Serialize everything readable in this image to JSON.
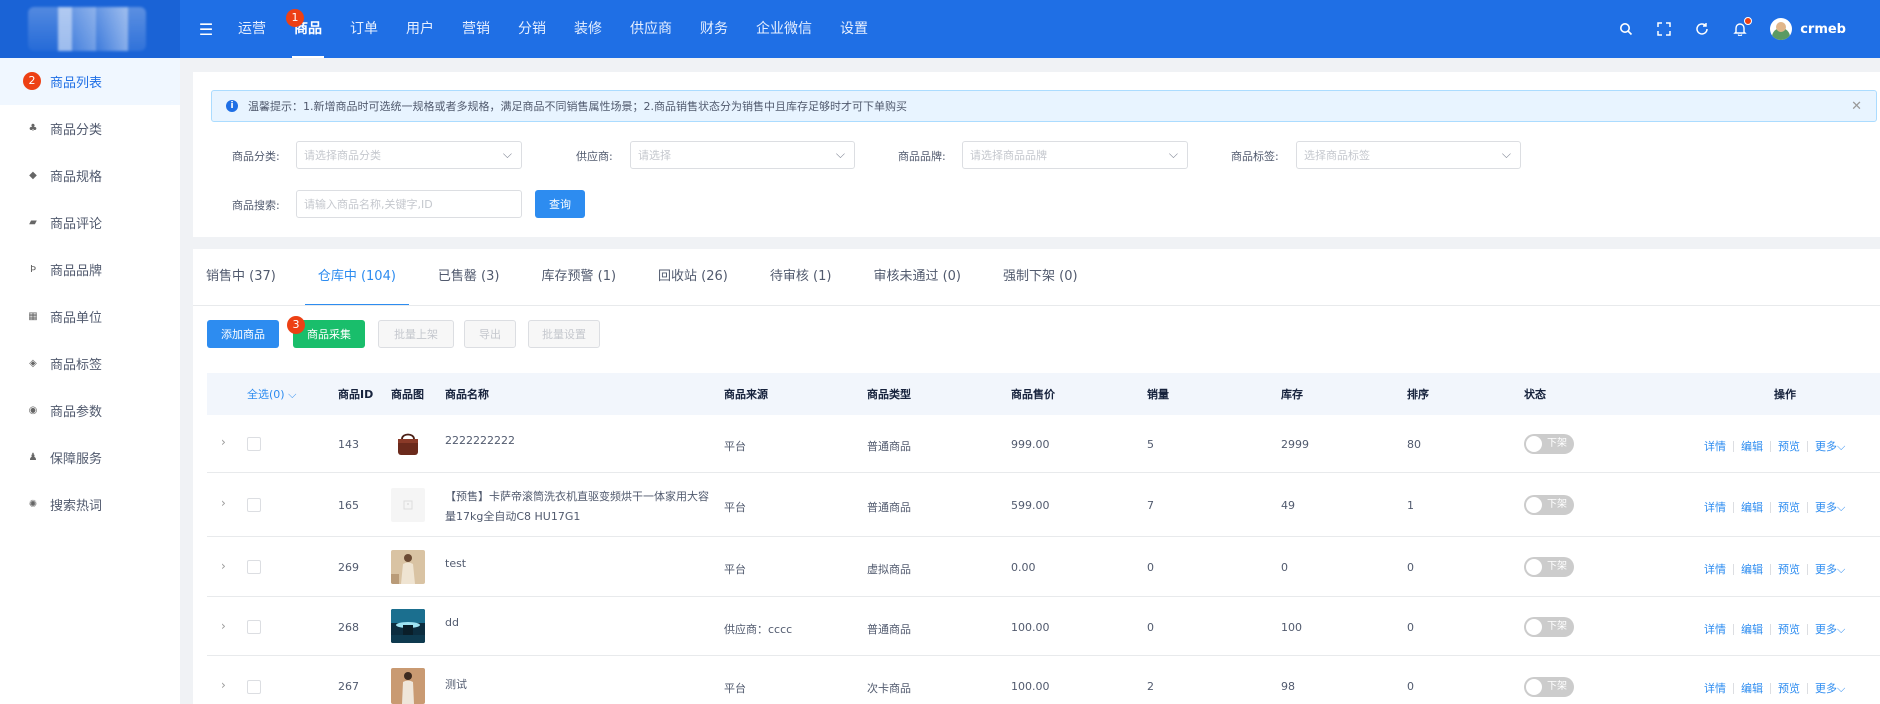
{
  "header": {
    "nav": [
      {
        "label": "运营"
      },
      {
        "label": "商品",
        "badge": "1"
      },
      {
        "label": "订单"
      },
      {
        "label": "用户"
      },
      {
        "label": "营销"
      },
      {
        "label": "分销"
      },
      {
        "label": "装修"
      },
      {
        "label": "供应商"
      },
      {
        "label": "财务"
      },
      {
        "label": "企业微信"
      },
      {
        "label": "设置"
      }
    ],
    "active_nav_index": 1,
    "icons": [
      "search-icon",
      "fullscreen-icon",
      "refresh-icon",
      "bell-icon"
    ],
    "username": "crmeb"
  },
  "sidebar": {
    "items": [
      {
        "label": "商品列表",
        "icon": "list-icon",
        "badge": "2"
      },
      {
        "label": "商品分类",
        "icon": "category-icon"
      },
      {
        "label": "商品规格",
        "icon": "spec-icon"
      },
      {
        "label": "商品评论",
        "icon": "comment-icon"
      },
      {
        "label": "商品品牌",
        "icon": "brand-icon"
      },
      {
        "label": "商品单位",
        "icon": "unit-icon"
      },
      {
        "label": "商品标签",
        "icon": "tag-icon"
      },
      {
        "label": "商品参数",
        "icon": "param-icon"
      },
      {
        "label": "保障服务",
        "icon": "guarantee-icon"
      },
      {
        "label": "搜索热词",
        "icon": "hotword-icon"
      }
    ]
  },
  "tip": {
    "text": "温馨提示：1.新增商品时可选统一规格或者多规格，满足商品不同销售属性场景；2.商品销售状态分为销售中且库存足够时才可下单购买"
  },
  "filters": {
    "category_label": "商品分类:",
    "category_placeholder": "请选择商品分类",
    "supplier_label": "供应商:",
    "supplier_placeholder": "请选择",
    "brand_label": "商品品牌:",
    "brand_placeholder": "请选择商品品牌",
    "tag_label": "商品标签:",
    "tag_placeholder": "选择商品标签",
    "search_label": "商品搜索:",
    "search_placeholder": "请输入商品名称,关键字,ID",
    "query_button": "查询"
  },
  "tabs": [
    {
      "label": "销售中 (37)"
    },
    {
      "label": "仓库中 (104)"
    },
    {
      "label": "已售罄 (3)"
    },
    {
      "label": "库存预警 (1)"
    },
    {
      "label": "回收站 (26)"
    },
    {
      "label": "待审核 (1)"
    },
    {
      "label": "审核未通过 (0)"
    },
    {
      "label": "强制下架 (0)"
    }
  ],
  "active_tab_index": 1,
  "actions": {
    "add": "添加商品",
    "collect": "商品采集",
    "collect_badge": "3",
    "batch_on": "批量上架",
    "export": "导出",
    "batch_settings": "批量设置"
  },
  "table": {
    "headers": {
      "select_all": "全选(0)",
      "id": "商品ID",
      "image": "商品图",
      "name": "商品名称",
      "source": "商品来源",
      "type": "商品类型",
      "price": "商品售价",
      "sales": "销量",
      "stock": "库存",
      "sort": "排序",
      "status": "状态",
      "ops": "操作"
    },
    "rows": [
      {
        "id": "143",
        "name_line1": "2222222222",
        "name_line2": "",
        "source": "平台",
        "type": "普通商品",
        "price": "999.00",
        "sales": "5",
        "stock": "2999",
        "sort": "80",
        "status": "下架",
        "thumb": "bag"
      },
      {
        "id": "165",
        "name_line1": "【预售】卡萨帝滚筒洗衣机直驱变频烘干一体家用大容",
        "name_line2": "量17kg全自动C8 HU17G1",
        "source": "平台",
        "type": "普通商品",
        "price": "599.00",
        "sales": "7",
        "stock": "49",
        "sort": "1",
        "status": "下架",
        "thumb": "placeholder"
      },
      {
        "id": "269",
        "name_line1": "test",
        "name_line2": "",
        "source": "平台",
        "type": "虚拟商品",
        "price": "0.00",
        "sales": "0",
        "stock": "0",
        "sort": "0",
        "status": "下架",
        "thumb": "fashion"
      },
      {
        "id": "268",
        "name_line1": "dd",
        "name_line2": "",
        "source": "供应商：cccc",
        "type": "普通商品",
        "price": "100.00",
        "sales": "0",
        "stock": "100",
        "sort": "0",
        "status": "下架",
        "thumb": "scene"
      },
      {
        "id": "267",
        "name_line1": "测试",
        "name_line2": "",
        "source": "平台",
        "type": "次卡商品",
        "price": "100.00",
        "sales": "2",
        "stock": "98",
        "sort": "0",
        "status": "下架",
        "thumb": "person"
      }
    ],
    "ops": {
      "detail": "详情",
      "edit": "编辑",
      "preview": "预览",
      "more": "更多"
    }
  }
}
